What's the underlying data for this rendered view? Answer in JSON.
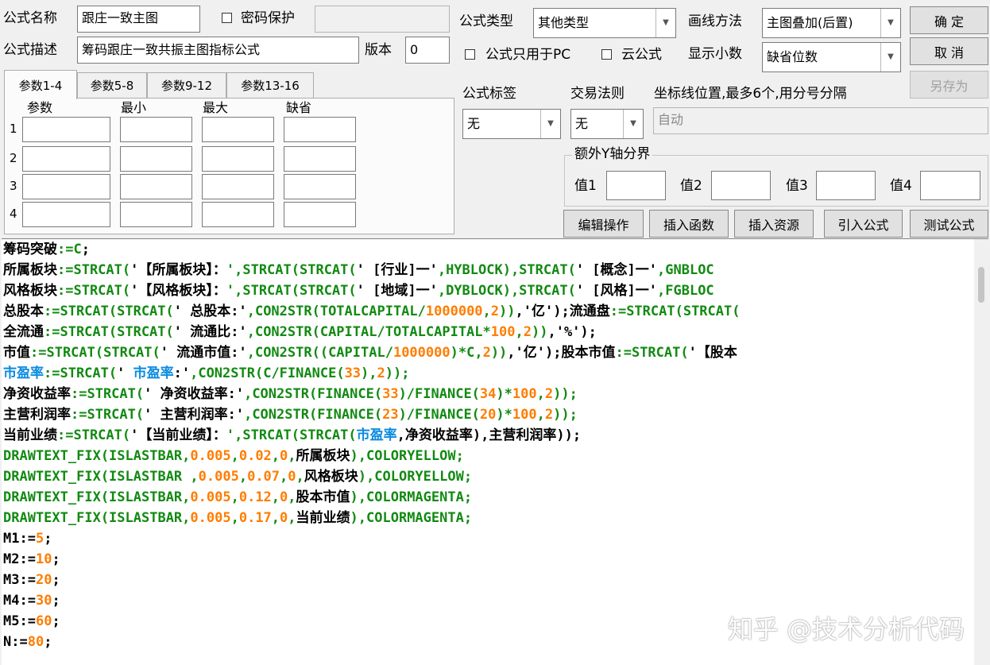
{
  "header": {
    "name_label": "公式名称",
    "name_value": "跟庄一致主图",
    "password_label": "密码保护",
    "password_value": "",
    "desc_label": "公式描述",
    "desc_value": "筹码跟庄一致共振主图指标公式",
    "version_label": "版本",
    "version_value": "0",
    "type_label": "公式类型",
    "type_value": "其他类型",
    "draw_label": "画线方法",
    "draw_value": "主图叠加(后置)",
    "pc_only_label": "公式只用于PC",
    "cloud_label": "云公式",
    "decimals_label": "显示小数",
    "decimals_value": "缺省位数",
    "tag_label": "公式标签",
    "tag_value": "无",
    "trade_label": "交易法则",
    "trade_value": "无",
    "axis_label": "坐标线位置,最多6个,用分号分隔",
    "axis_value": "自动",
    "extra_y_label": "额外Y轴分界",
    "v1_label": "值1",
    "v2_label": "值2",
    "v3_label": "值3",
    "v4_label": "值4"
  },
  "buttons": {
    "ok": "确  定",
    "cancel": "取  消",
    "save_as": "另存为",
    "edit": "编辑操作",
    "insert_func": "插入函数",
    "insert_res": "插入资源",
    "import": "引入公式",
    "test": "测试公式"
  },
  "tabs": [
    "参数1-4",
    "参数5-8",
    "参数9-12",
    "参数13-16"
  ],
  "params": {
    "col_param": "参数",
    "col_min": "最小",
    "col_max": "最大",
    "col_default": "缺省",
    "rows": [
      "1",
      "2",
      "3",
      "4"
    ]
  },
  "colors": {
    "green": "#128a12",
    "orange": "#ff7d00",
    "blue": "#0a8be0",
    "black": "#000000"
  },
  "code_lines": [
    [
      [
        "black",
        "筹码突破"
      ],
      [
        "green",
        ":="
      ],
      [
        "green",
        "C"
      ],
      [
        "black",
        ";"
      ]
    ],
    [
      [
        "black",
        "所属板块"
      ],
      [
        "green",
        ":=STRCAT("
      ],
      [
        "black",
        "'【所属板块】："
      ],
      [
        "green",
        "',STRCAT(STRCAT("
      ],
      [
        "black",
        "' [行业]一'"
      ],
      [
        "green",
        ",HYBLOCK),STRCAT("
      ],
      [
        "black",
        "' [概念]一'"
      ],
      [
        "green",
        ",GNBLOC"
      ]
    ],
    [
      [
        "black",
        "风格板块"
      ],
      [
        "green",
        ":=STRCAT("
      ],
      [
        "black",
        "'【风格板块】："
      ],
      [
        "green",
        "',STRCAT(STRCAT("
      ],
      [
        "black",
        "' [地域]一'"
      ],
      [
        "green",
        ",DYBLOCK),STRCAT("
      ],
      [
        "black",
        "' [风格]一'"
      ],
      [
        "green",
        ",FGBLOC"
      ]
    ],
    [
      [
        "black",
        "总股本"
      ],
      [
        "green",
        ":=STRCAT(STRCAT("
      ],
      [
        "black",
        "' 总股本:'"
      ],
      [
        "green",
        ",CON2STR(TOTALCAPITAL/"
      ],
      [
        "orange",
        "1000000"
      ],
      [
        "green",
        ","
      ],
      [
        "orange",
        "2"
      ],
      [
        "green",
        "))"
      ],
      [
        "black",
        ",'亿');流通盘"
      ],
      [
        "green",
        ":=STRCAT(STRCAT("
      ]
    ],
    [
      [
        "black",
        "全流通"
      ],
      [
        "green",
        ":=STRCAT(STRCAT("
      ],
      [
        "black",
        "' 流通比:'"
      ],
      [
        "green",
        ",CON2STR(CAPITAL/TOTALCAPITAL*"
      ],
      [
        "orange",
        "100"
      ],
      [
        "green",
        ","
      ],
      [
        "orange",
        "2"
      ],
      [
        "green",
        "))"
      ],
      [
        "black",
        ",'%');"
      ]
    ],
    [
      [
        "black",
        "市值"
      ],
      [
        "green",
        ":=STRCAT(STRCAT("
      ],
      [
        "black",
        "' 流通市值:'"
      ],
      [
        "green",
        ",CON2STR((CAPITAL/"
      ],
      [
        "orange",
        "1000000"
      ],
      [
        "green",
        ")*C,"
      ],
      [
        "orange",
        "2"
      ],
      [
        "green",
        "))"
      ],
      [
        "black",
        ",'亿');股本市值"
      ],
      [
        "green",
        ":=STRCAT("
      ],
      [
        "black",
        "'【股本"
      ]
    ],
    [
      [
        "blue",
        "市盈率"
      ],
      [
        "green",
        ":=STRCAT("
      ],
      [
        "black",
        "' "
      ],
      [
        "blue",
        "市盈率"
      ],
      [
        "black",
        ":'"
      ],
      [
        "green",
        ",CON2STR(C/FINANCE("
      ],
      [
        "orange",
        "33"
      ],
      [
        "green",
        "),"
      ],
      [
        "orange",
        "2"
      ],
      [
        "green",
        "));"
      ]
    ],
    [
      [
        "black",
        "净资收益率"
      ],
      [
        "green",
        ":=STRCAT("
      ],
      [
        "black",
        "' 净资收益率:'"
      ],
      [
        "green",
        ",CON2STR(FINANCE("
      ],
      [
        "orange",
        "33"
      ],
      [
        "green",
        ")/FINANCE("
      ],
      [
        "orange",
        "34"
      ],
      [
        "green",
        ")*"
      ],
      [
        "orange",
        "100"
      ],
      [
        "green",
        ","
      ],
      [
        "orange",
        "2"
      ],
      [
        "green",
        "));"
      ]
    ],
    [
      [
        "black",
        "主营利润率"
      ],
      [
        "green",
        ":=STRCAT("
      ],
      [
        "black",
        "' 主营利润率:'"
      ],
      [
        "green",
        ",CON2STR(FINANCE("
      ],
      [
        "orange",
        "23"
      ],
      [
        "green",
        ")/FINANCE("
      ],
      [
        "orange",
        "20"
      ],
      [
        "green",
        ")*"
      ],
      [
        "orange",
        "100"
      ],
      [
        "green",
        ","
      ],
      [
        "orange",
        "2"
      ],
      [
        "green",
        "));"
      ]
    ],
    [
      [
        "black",
        "当前业绩"
      ],
      [
        "green",
        ":=STRCAT("
      ],
      [
        "black",
        "'【当前业绩】："
      ],
      [
        "green",
        "',STRCAT(STRCAT("
      ],
      [
        "blue",
        "市盈率"
      ],
      [
        "black",
        ",净资收益率),主营利润率));"
      ]
    ],
    [
      [
        "green",
        "DRAWTEXT_FIX(ISLASTBAR,"
      ],
      [
        "orange",
        "0.005"
      ],
      [
        "green",
        ","
      ],
      [
        "orange",
        "0.02"
      ],
      [
        "green",
        ","
      ],
      [
        "orange",
        "0"
      ],
      [
        "green",
        ","
      ],
      [
        "black",
        "所属板块"
      ],
      [
        "green",
        "),COLORYELLOW;"
      ]
    ],
    [
      [
        "green",
        "DRAWTEXT_FIX(ISLASTBAR ,"
      ],
      [
        "orange",
        "0.005"
      ],
      [
        "green",
        ","
      ],
      [
        "orange",
        "0.07"
      ],
      [
        "green",
        ","
      ],
      [
        "orange",
        "0"
      ],
      [
        "green",
        ","
      ],
      [
        "black",
        "风格板块"
      ],
      [
        "green",
        "),COLORYELLOW;"
      ]
    ],
    [
      [
        "green",
        "DRAWTEXT_FIX(ISLASTBAR,"
      ],
      [
        "orange",
        "0.005"
      ],
      [
        "green",
        ","
      ],
      [
        "orange",
        "0.12"
      ],
      [
        "green",
        ","
      ],
      [
        "orange",
        "0"
      ],
      [
        "green",
        ","
      ],
      [
        "black",
        "股本市值"
      ],
      [
        "green",
        "),COLORMAGENTA;"
      ]
    ],
    [
      [
        "green",
        "DRAWTEXT_FIX(ISLASTBAR,"
      ],
      [
        "orange",
        "0.005"
      ],
      [
        "green",
        ","
      ],
      [
        "orange",
        "0.17"
      ],
      [
        "green",
        ","
      ],
      [
        "orange",
        "0"
      ],
      [
        "green",
        ","
      ],
      [
        "black",
        "当前业绩"
      ],
      [
        "green",
        "),COLORMAGENTA;"
      ]
    ],
    [
      [
        "black",
        "M1:="
      ],
      [
        "orange",
        "5"
      ],
      [
        "black",
        ";"
      ]
    ],
    [
      [
        "black",
        "M2:="
      ],
      [
        "orange",
        "10"
      ],
      [
        "black",
        ";"
      ]
    ],
    [
      [
        "black",
        "M3:="
      ],
      [
        "orange",
        "20"
      ],
      [
        "black",
        ";"
      ]
    ],
    [
      [
        "black",
        "M4:="
      ],
      [
        "orange",
        "30"
      ],
      [
        "black",
        ";"
      ]
    ],
    [
      [
        "black",
        "M5:="
      ],
      [
        "orange",
        "60"
      ],
      [
        "black",
        ";"
      ]
    ],
    [
      [
        "black",
        "N:="
      ],
      [
        "orange",
        "80"
      ],
      [
        "black",
        ";"
      ]
    ]
  ],
  "watermark": "知乎 @技术分析代码"
}
